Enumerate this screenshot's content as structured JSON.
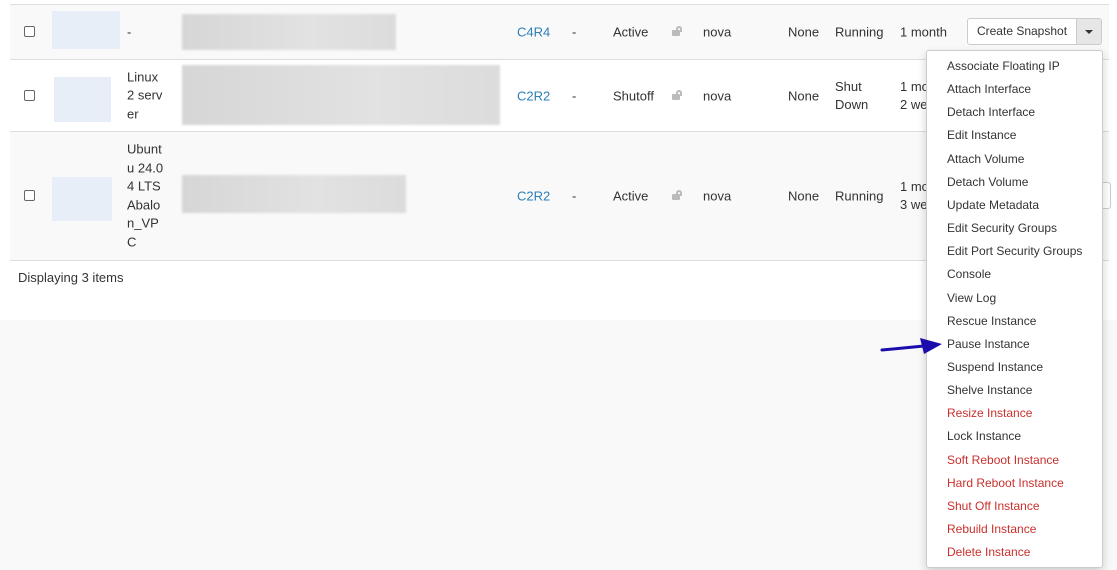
{
  "rows": [
    {
      "name": "-",
      "flavor": "C4R4",
      "key_pair": "-",
      "status": "Active",
      "zone": "nova",
      "task": "None",
      "power_state": "Running",
      "age": "1 month"
    },
    {
      "name": "Linux 2 server",
      "flavor": "C2R2",
      "key_pair": "-",
      "status": "Shutoff",
      "zone": "nova",
      "task": "None",
      "power_state": "Shut Down",
      "age": "1 mo 2 we"
    },
    {
      "name": "Ubuntu 24.04 LTS Abalon_VPC",
      "flavor": "C2R2",
      "key_pair": "-",
      "status": "Active",
      "zone": "nova",
      "task": "None",
      "power_state": "Running",
      "age": "1 mo 3 we"
    }
  ],
  "footer": {
    "count_text": "Displaying 3 items"
  },
  "actions": {
    "primary_label": "Create Snapshot",
    "menu": [
      {
        "label": "Associate Floating IP",
        "danger": false
      },
      {
        "label": "Attach Interface",
        "danger": false
      },
      {
        "label": "Detach Interface",
        "danger": false
      },
      {
        "label": "Edit Instance",
        "danger": false
      },
      {
        "label": "Attach Volume",
        "danger": false
      },
      {
        "label": "Detach Volume",
        "danger": false
      },
      {
        "label": "Update Metadata",
        "danger": false
      },
      {
        "label": "Edit Security Groups",
        "danger": false
      },
      {
        "label": "Edit Port Security Groups",
        "danger": false
      },
      {
        "label": "Console",
        "danger": false
      },
      {
        "label": "View Log",
        "danger": false
      },
      {
        "label": "Rescue Instance",
        "danger": false
      },
      {
        "label": "Pause Instance",
        "danger": false
      },
      {
        "label": "Suspend Instance",
        "danger": false
      },
      {
        "label": "Shelve Instance",
        "danger": false
      },
      {
        "label": "Resize Instance",
        "danger": true
      },
      {
        "label": "Lock Instance",
        "danger": false
      },
      {
        "label": "Soft Reboot Instance",
        "danger": true
      },
      {
        "label": "Hard Reboot Instance",
        "danger": true
      },
      {
        "label": "Shut Off Instance",
        "danger": true
      },
      {
        "label": "Rebuild Instance",
        "danger": true
      },
      {
        "label": "Delete Instance",
        "danger": true
      }
    ]
  },
  "colors": {
    "link": "#2d7fb8",
    "danger": "#c9302c",
    "annotation_arrow": "#1a0dab"
  },
  "icons": {
    "lock": "unlocked-padlock-icon",
    "caret": "caret-down-icon",
    "pointer": "arrow-right-icon"
  }
}
